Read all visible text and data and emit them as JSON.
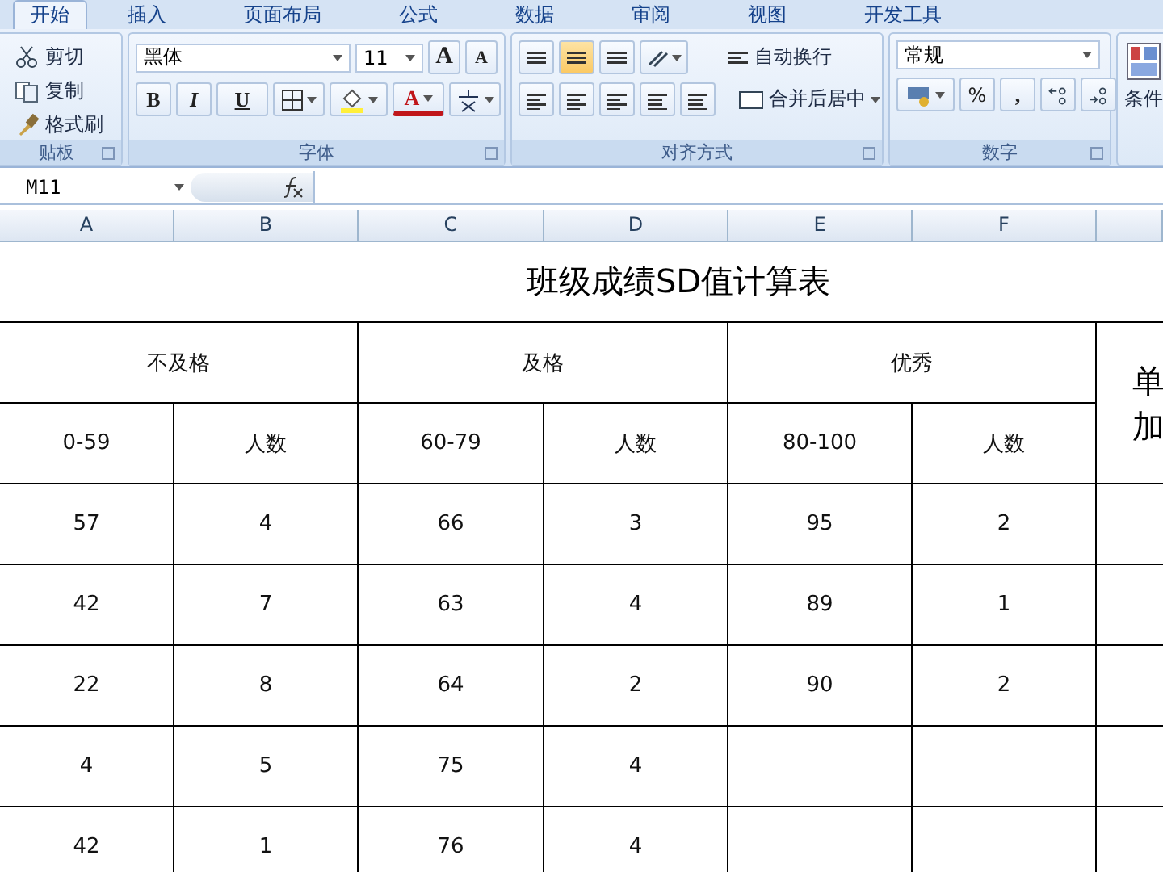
{
  "ribbon": {
    "tabs": [
      {
        "label": "开始",
        "selected": true
      },
      {
        "label": "插入",
        "selected": false
      },
      {
        "label": "页面布局",
        "selected": false
      },
      {
        "label": "公式",
        "selected": false
      },
      {
        "label": "数据",
        "selected": false
      },
      {
        "label": "审阅",
        "selected": false
      },
      {
        "label": "视图",
        "selected": false
      },
      {
        "label": "开发工具",
        "selected": false
      }
    ],
    "clipboard": {
      "items": [
        "剪切",
        "复制",
        "格式刷"
      ],
      "label": "贴板"
    },
    "font": {
      "name": "黑体",
      "size": "11",
      "grow": "A",
      "shrink": "A",
      "bold": "B",
      "italic": "I",
      "underline": "U",
      "color_letter": "A",
      "label": "字体"
    },
    "alignment": {
      "vertical": [
        {
          "selected": false
        },
        {
          "selected": true
        },
        {
          "selected": false
        }
      ],
      "wrap": "自动换行",
      "merge": "合并后居中",
      "label": "对齐方式"
    },
    "number": {
      "format": "常规",
      "percent": "%",
      "comma": ",",
      "label": "数字"
    },
    "styles": {
      "conditional": "条件"
    }
  },
  "formula_bar": {
    "name_box": "M11"
  },
  "columns": [
    "A",
    "B",
    "C",
    "D",
    "E",
    "F"
  ],
  "sheet": {
    "title": "班级成绩SD值计算表",
    "groups": [
      "不及格",
      "及格",
      "优秀"
    ],
    "side_header": "单加",
    "subheaders": [
      "0-59",
      "人数",
      "60-79",
      "人数",
      "80-100",
      "人数"
    ],
    "rows": [
      [
        "57",
        "4",
        "66",
        "3",
        "95",
        "2"
      ],
      [
        "42",
        "7",
        "63",
        "4",
        "89",
        "1"
      ],
      [
        "22",
        "8",
        "64",
        "2",
        "90",
        "2"
      ],
      [
        "4",
        "5",
        "75",
        "4"
      ],
      [
        "42",
        "1",
        "76",
        "4"
      ]
    ]
  }
}
